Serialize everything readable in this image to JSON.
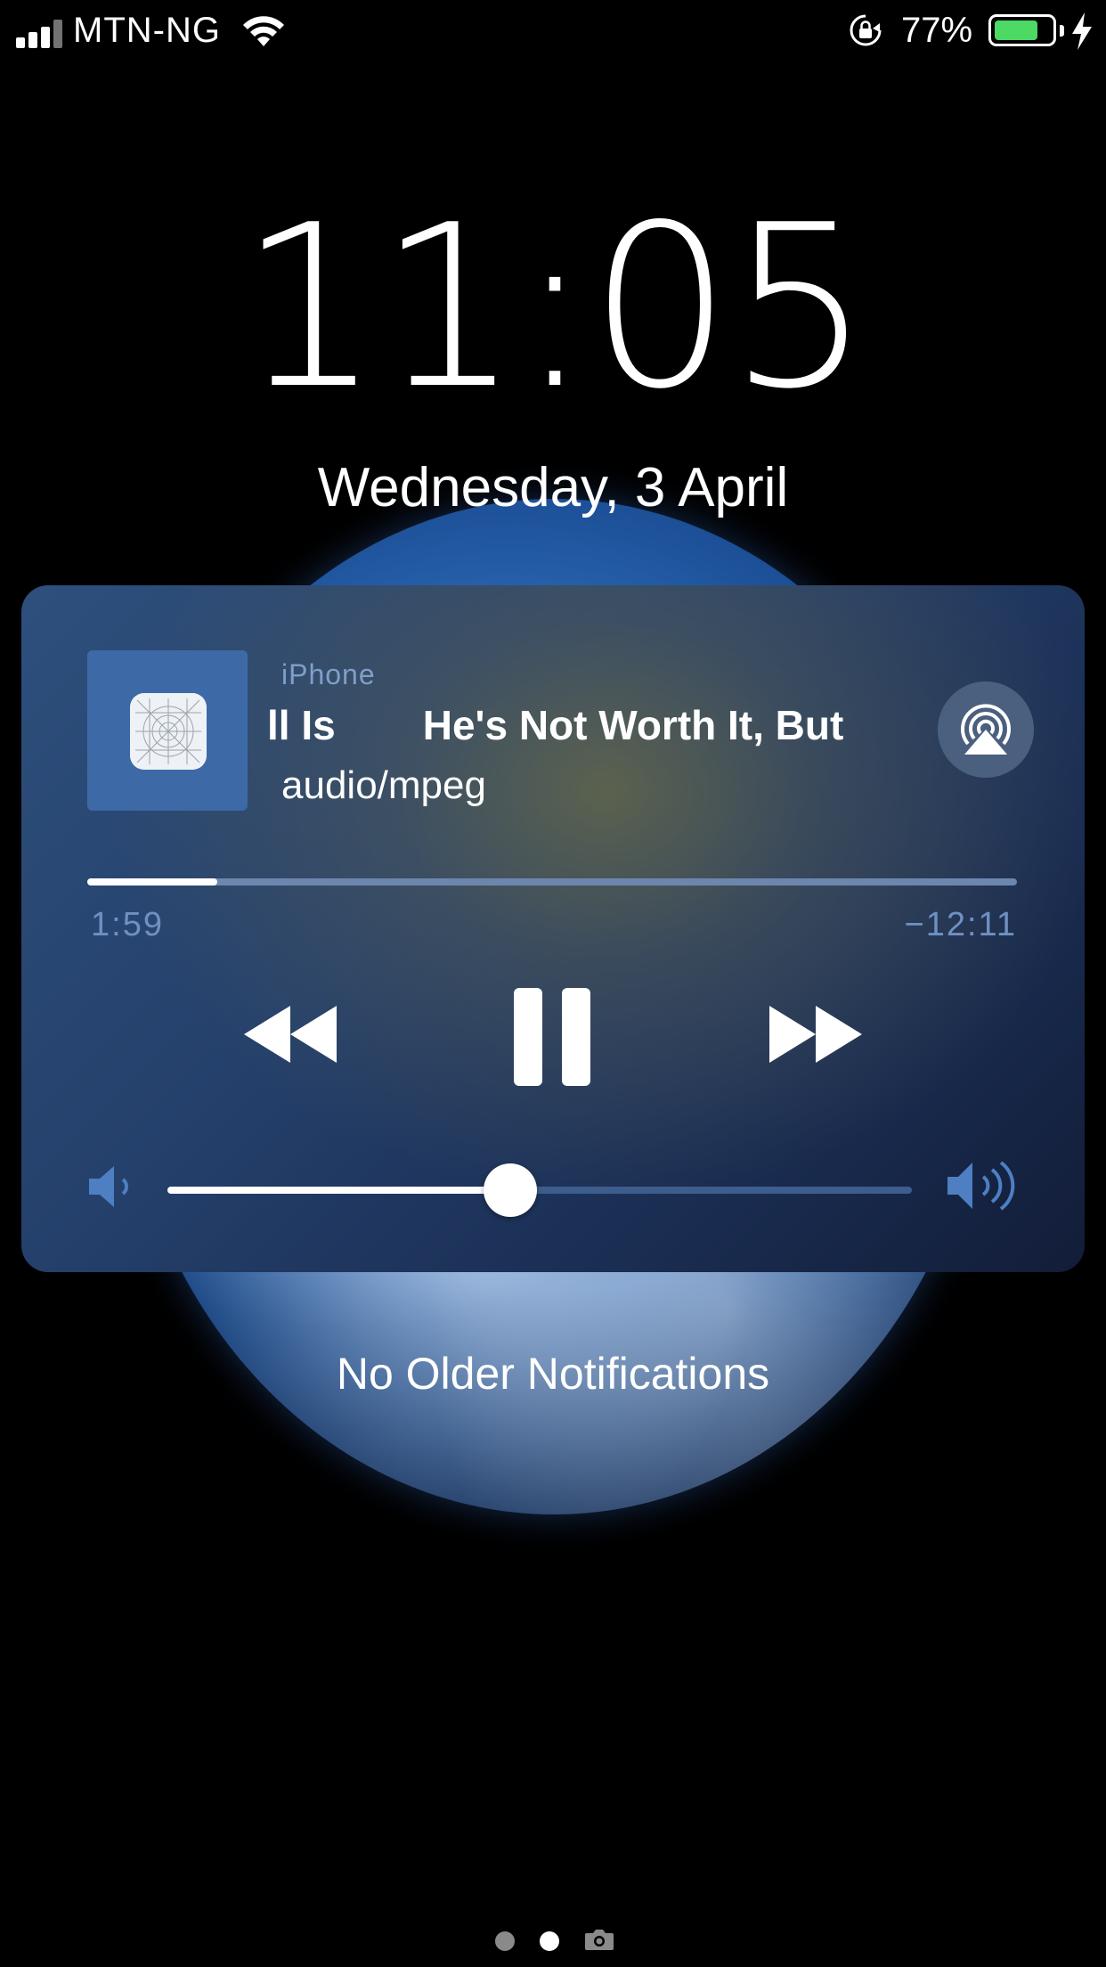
{
  "status_bar": {
    "carrier": "MTN-NG",
    "battery_percent": "77%",
    "battery_level": 0.77,
    "icons": [
      "signal-icon",
      "wifi-icon",
      "rotation-lock-icon",
      "battery-icon",
      "charging-icon"
    ]
  },
  "lock_screen": {
    "time": "11:05",
    "date": "Wednesday, 3 April",
    "no_older_notifications": "No Older Notifications"
  },
  "media": {
    "source": "iPhone",
    "title_part1": "ll Is",
    "title_part2": "He's Not Worth It, But",
    "subtitle": "audio/mpeg",
    "elapsed": "1:59",
    "remaining": "−12:11",
    "progress": 0.14,
    "volume": 0.46,
    "controls": [
      "rewind-icon",
      "pause-icon",
      "fast-forward-icon",
      "airplay-icon",
      "volume-low-icon",
      "volume-high-icon"
    ]
  },
  "page_indicator": {
    "pages": 3,
    "current": 1,
    "last_icon": "camera-icon"
  },
  "colors": {
    "battery_fill": "#4cd964",
    "accent_blue": "#6f91c2"
  }
}
